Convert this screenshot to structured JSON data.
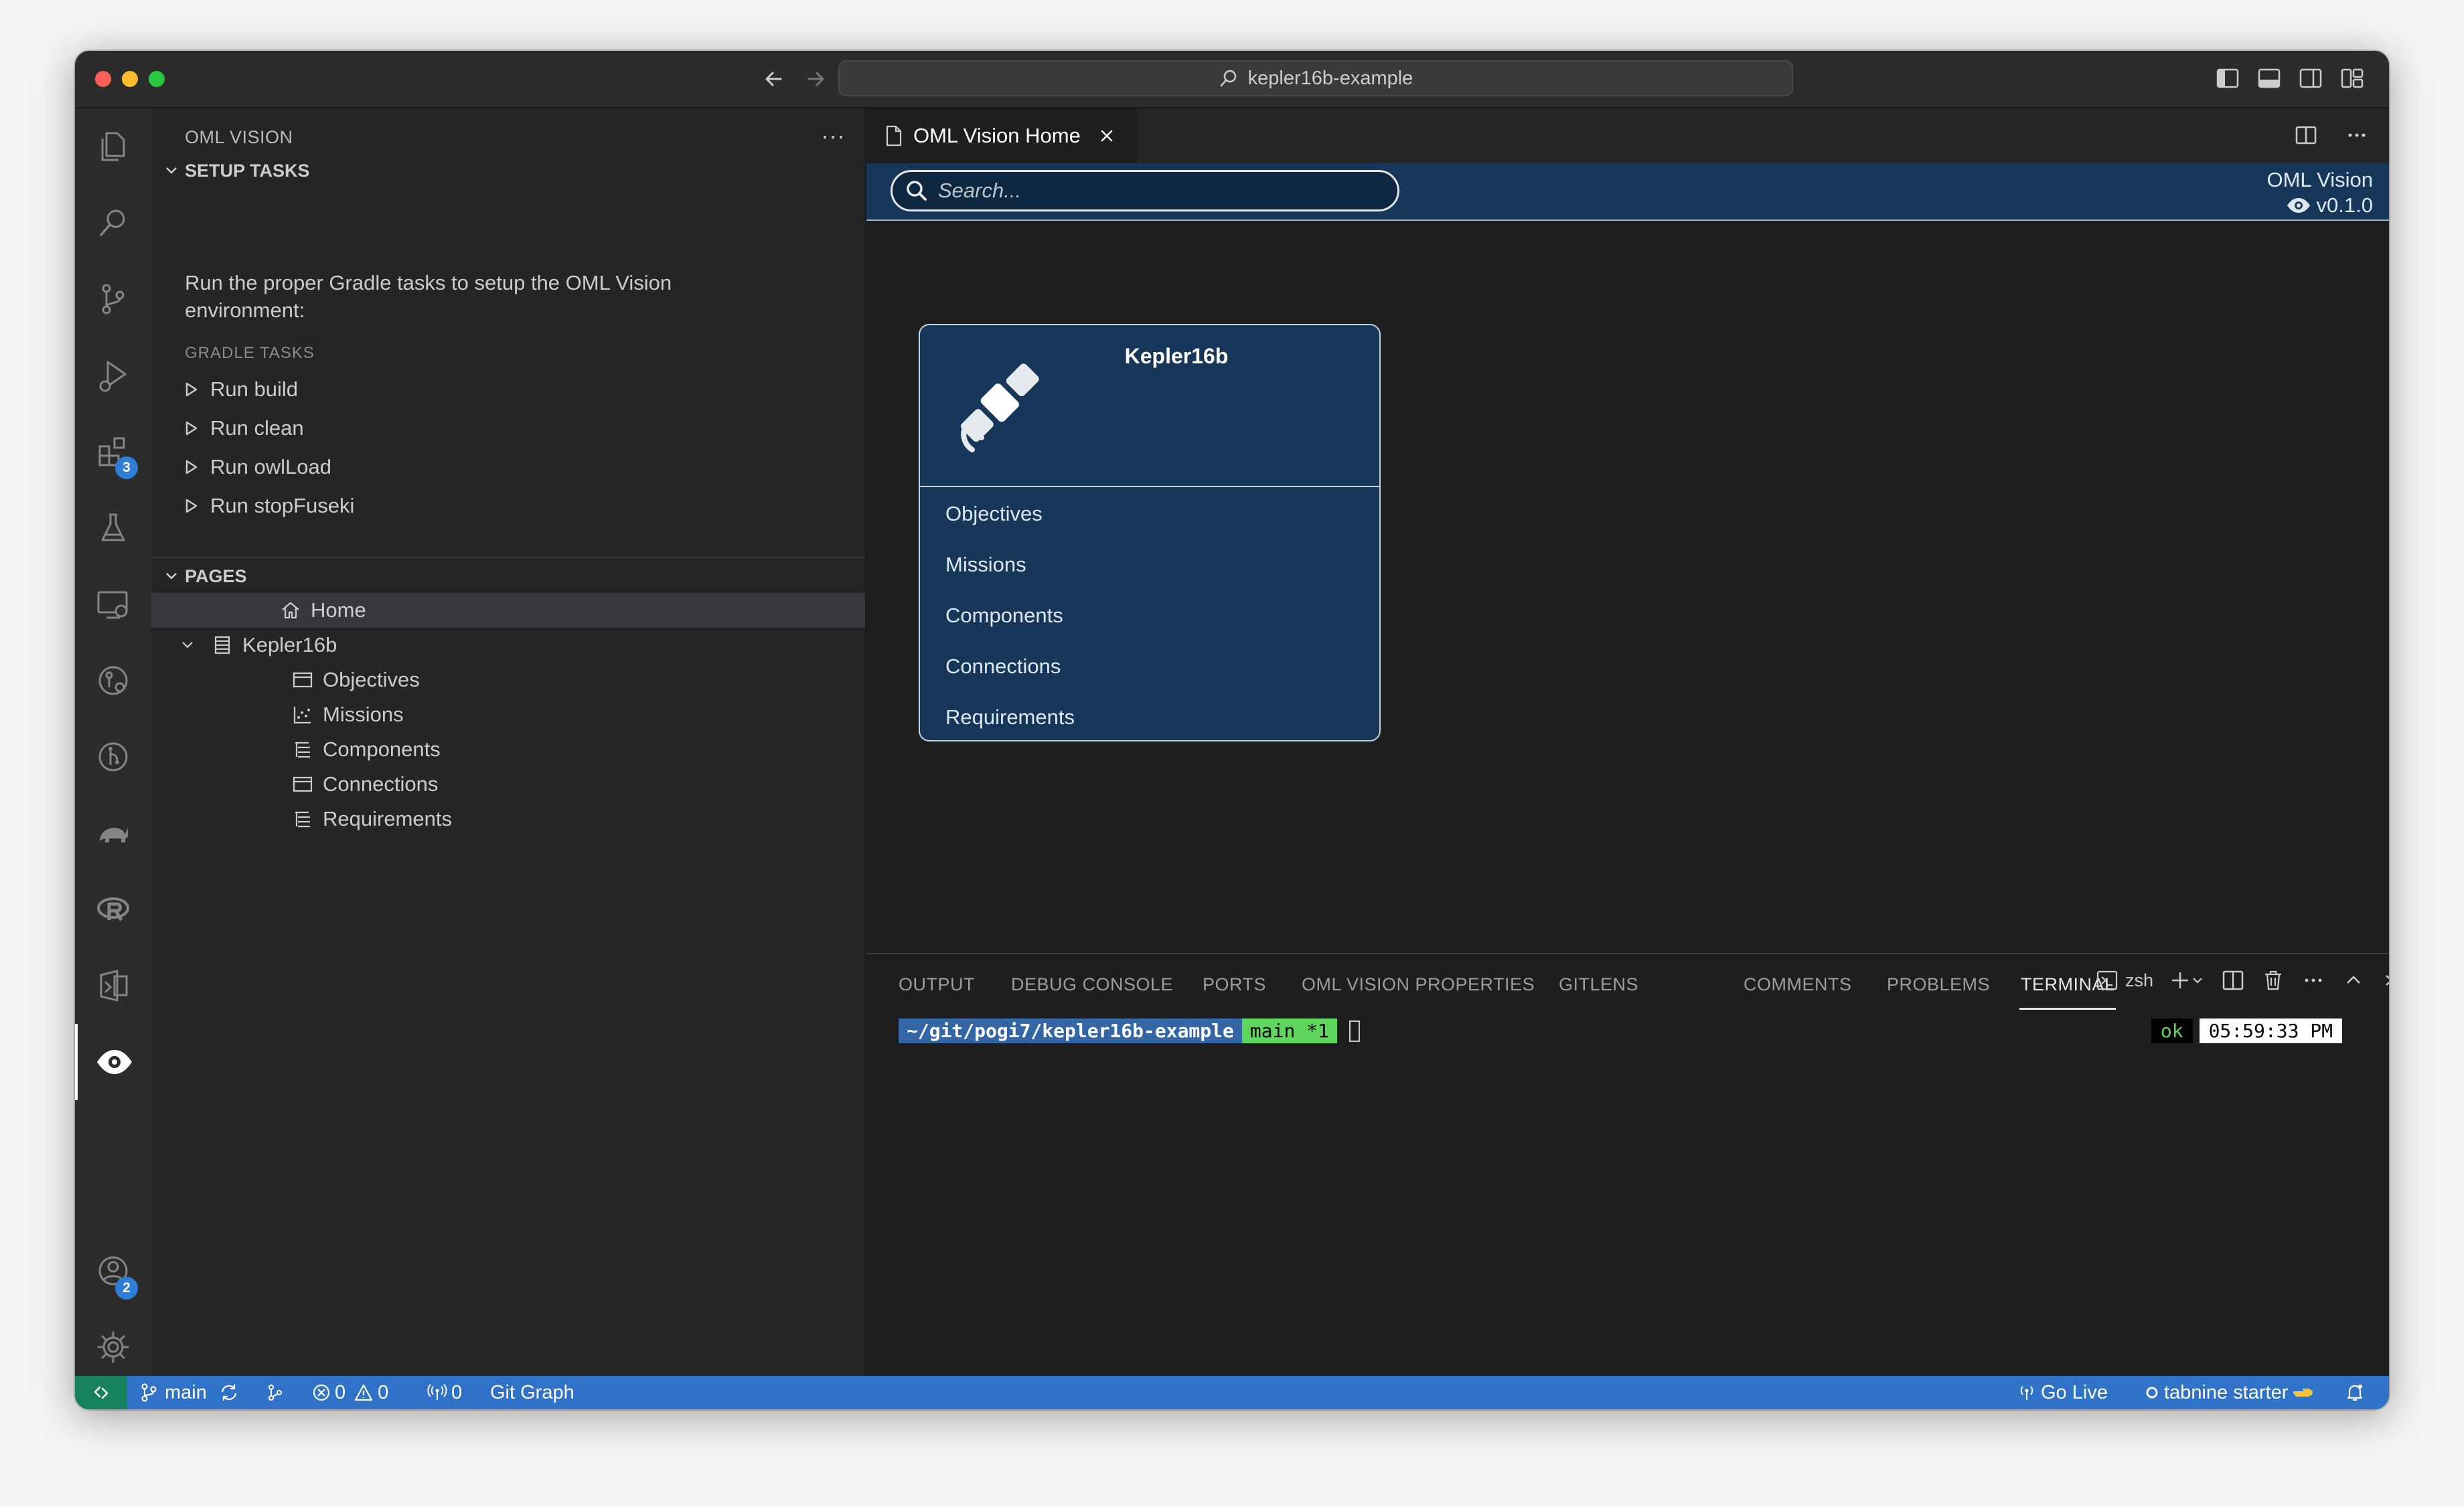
{
  "window": {
    "command_center": "kepler16b-example"
  },
  "activity_bar": {
    "extensions_badge": "3",
    "accounts_badge": "2"
  },
  "sidebar": {
    "title": "OML VISION",
    "more": "···",
    "setup_tasks": {
      "header": "SETUP TASKS",
      "description": "Run the proper Gradle tasks to setup the OML Vision environment:",
      "sub_label": "GRADLE TASKS",
      "tasks": [
        "Run build",
        "Run clean",
        "Run owlLoad",
        "Run stopFuseki"
      ]
    },
    "pages": {
      "header": "PAGES",
      "home": "Home",
      "group": "Kepler16b",
      "children": [
        "Objectives",
        "Missions",
        "Components",
        "Connections",
        "Requirements"
      ]
    }
  },
  "editor": {
    "tab_label": "OML Vision Home",
    "search_placeholder": "Search...",
    "brand_name": "OML Vision",
    "brand_version": "v0.1.0",
    "card": {
      "title": "Kepler16b",
      "items": [
        "Objectives",
        "Missions",
        "Components",
        "Connections",
        "Requirements"
      ]
    }
  },
  "panel": {
    "tabs": [
      "OUTPUT",
      "DEBUG CONSOLE",
      "PORTS",
      "OML VISION PROPERTIES",
      "GITLENS",
      "COMMENTS",
      "PROBLEMS",
      "TERMINAL"
    ],
    "active_tab": "TERMINAL",
    "shell": "zsh",
    "terminal": {
      "path": "~/git/pogi7/kepler16b-example",
      "branch": "main *1",
      "status": "ok",
      "time": "05:59:33 PM"
    }
  },
  "statusbar": {
    "branch": "main",
    "errors": "0",
    "warnings": "0",
    "ports": "0",
    "git_graph": "Git Graph",
    "go_live": "Go Live",
    "tabnine": "tabnine starter"
  },
  "colors": {
    "accent": "#2f72c8",
    "oml_header": "#16375a",
    "remote": "#16825d"
  }
}
